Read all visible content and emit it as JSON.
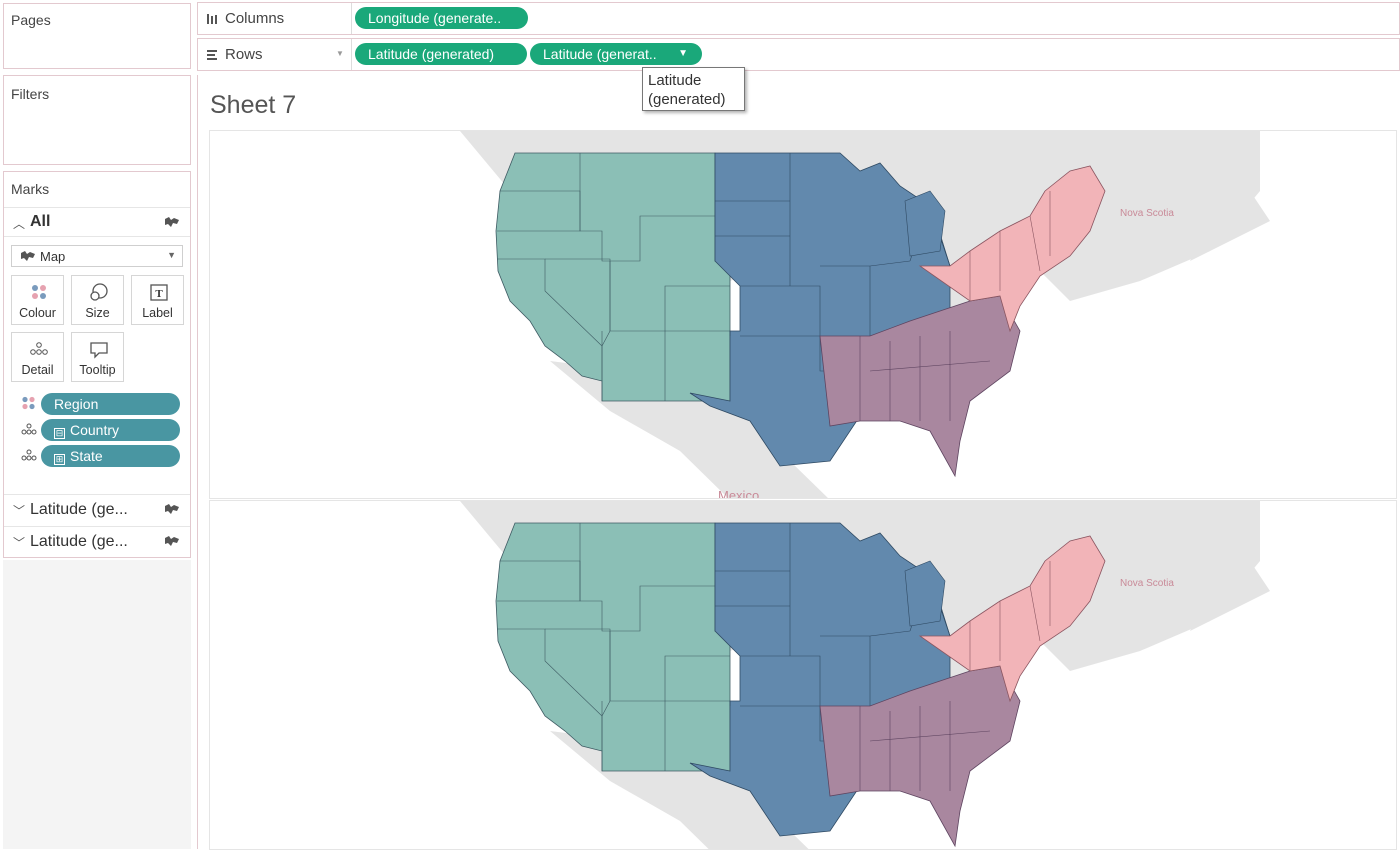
{
  "panes": {
    "pages_title": "Pages",
    "filters_title": "Filters",
    "marks_title": "Marks"
  },
  "marks": {
    "all_label": "All",
    "mark_type": "Map",
    "buttons": {
      "colour": "Colour",
      "size": "Size",
      "label": "Label",
      "detail": "Detail",
      "tooltip": "Tooltip"
    },
    "fields": [
      {
        "label": "Region",
        "encoding": "colour",
        "prefix": ""
      },
      {
        "label": "Country",
        "encoding": "detail",
        "prefix": "⊟"
      },
      {
        "label": "State",
        "encoding": "detail",
        "prefix": "⊞"
      }
    ],
    "lat_cards": [
      "Latitude (ge...",
      "Latitude (ge..."
    ]
  },
  "shelves": {
    "columns_label": "Columns",
    "rows_label": "Rows",
    "columns_pills": [
      "Longitude (generate.."
    ],
    "rows_pills": [
      "Latitude (generated)",
      "Latitude (generat.."
    ]
  },
  "tooltip": {
    "line1": "Latitude",
    "line2": "(generated)"
  },
  "sheet_title": "Sheet 7",
  "map": {
    "labels": {
      "nova_scotia": "Nova Scotia",
      "mexico": "Mexico"
    },
    "colors": {
      "west": "#8bbfb6",
      "central": "#6289ad",
      "south": "#a9879f",
      "east": "#f2b4b8",
      "land": "#e4e4e4",
      "ocean": "#ffffff"
    }
  }
}
